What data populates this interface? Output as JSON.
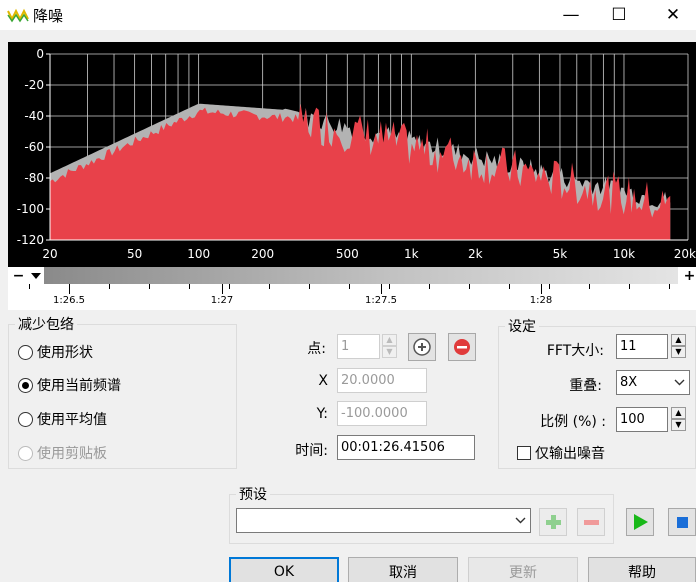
{
  "window": {
    "title": "降噪",
    "minimize_glyph": "—",
    "maximize_glyph": "☐",
    "close_glyph": "✕"
  },
  "graph": {
    "y_ticks": [
      "0",
      "-20",
      "-40",
      "-60",
      "-80",
      "-100",
      "-120"
    ],
    "x_ticks": [
      "20",
      "50",
      "100",
      "200",
      "500",
      "1k",
      "2k",
      "5k",
      "10k",
      "20k"
    ],
    "fill_color": "#e8414a",
    "profile_color": "#b3b3b3"
  },
  "zoom": {
    "minus": "−",
    "plus": "+"
  },
  "timeline": {
    "labels": [
      "1:26.5",
      "1:27",
      "1:27.5",
      "1:28"
    ]
  },
  "reduce_group": {
    "title": "减少包络",
    "options": [
      {
        "label": "使用形状",
        "selected": false
      },
      {
        "label": "使用当前频谱",
        "selected": true
      },
      {
        "label": "使用平均值",
        "selected": false
      },
      {
        "label": "使用剪贴板",
        "selected": false,
        "disabled": true
      }
    ]
  },
  "point": {
    "label": "点:",
    "value": "1",
    "x_label": "X",
    "x_value": "20.0000",
    "y_label": "Y:",
    "y_value": "-100.0000",
    "time_label": "时间:",
    "time_value": "00:01:26.41506"
  },
  "settings": {
    "title": "设定",
    "fft_label": "FFT大小:",
    "fft_value": "11",
    "overlap_label": "重叠:",
    "overlap_value": "8X",
    "ratio_label": "比例 (%) :",
    "ratio_value": "100",
    "noise_only_label": "仅输出噪音"
  },
  "preset": {
    "title": "预设",
    "value": ""
  },
  "buttons": {
    "ok": "OK",
    "cancel": "取消",
    "update": "更新",
    "help": "帮助"
  }
}
